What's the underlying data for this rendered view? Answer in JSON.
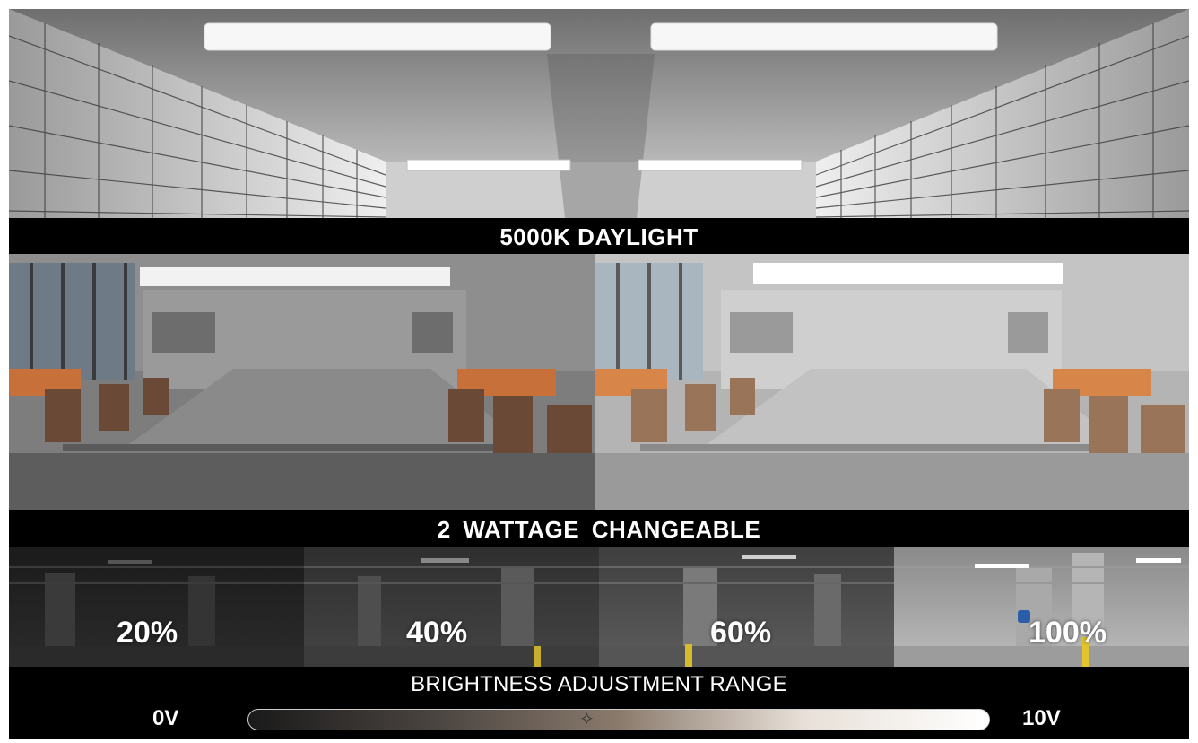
{
  "band_top": "5000K DAYLIGHT",
  "band_middle": "2  WATTAGE  CHANGEABLE",
  "brightness_levels": [
    "20%",
    "40%",
    "60%",
    "100%"
  ],
  "range": {
    "title": "BRIGHTNESS ADJUSTMENT RANGE",
    "min_label": "0V",
    "max_label": "10V"
  },
  "colors": {
    "band_background": "#000000",
    "text": "#ffffff",
    "chair_orange": "#c8703a"
  },
  "icons": [
    "lightbulb-icon"
  ]
}
